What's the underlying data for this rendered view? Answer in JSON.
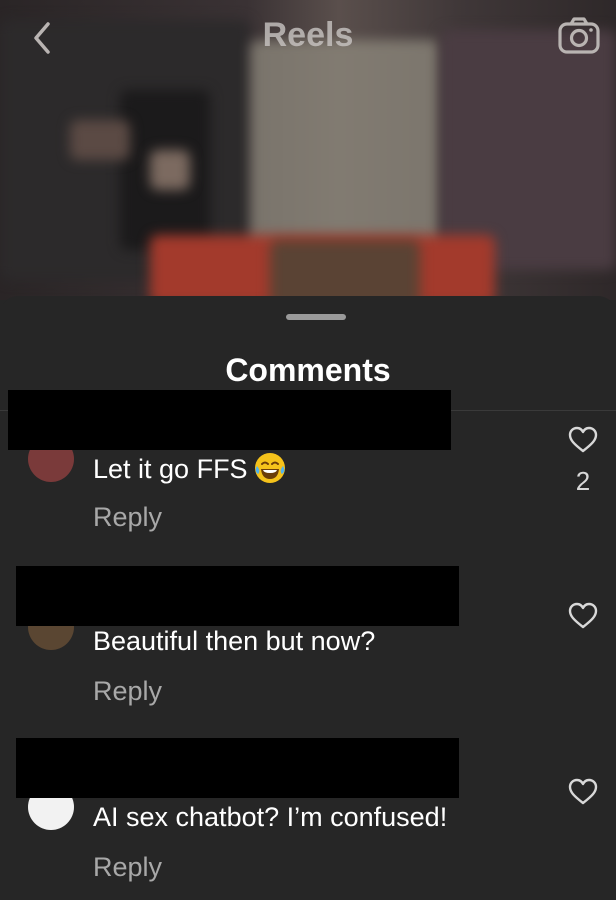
{
  "header": {
    "title": "Reels",
    "back_icon": "chevron-left-icon",
    "camera_icon": "camera-icon"
  },
  "sheet": {
    "title": "Comments"
  },
  "comments": [
    {
      "text": "Let it go FFS",
      "emoji": "face-with-tears-of-joy",
      "reply_label": "Reply",
      "like_count": "2"
    },
    {
      "text": "Beautiful then but now?",
      "reply_label": "Reply",
      "like_count": ""
    },
    {
      "text": "AI sex chatbot? I’m confused!",
      "reply_label": "Reply",
      "like_count": ""
    }
  ],
  "colors": {
    "sheet_bg": "#262626",
    "secondary_text": "#a8a8a8",
    "redaction": "#000000"
  }
}
